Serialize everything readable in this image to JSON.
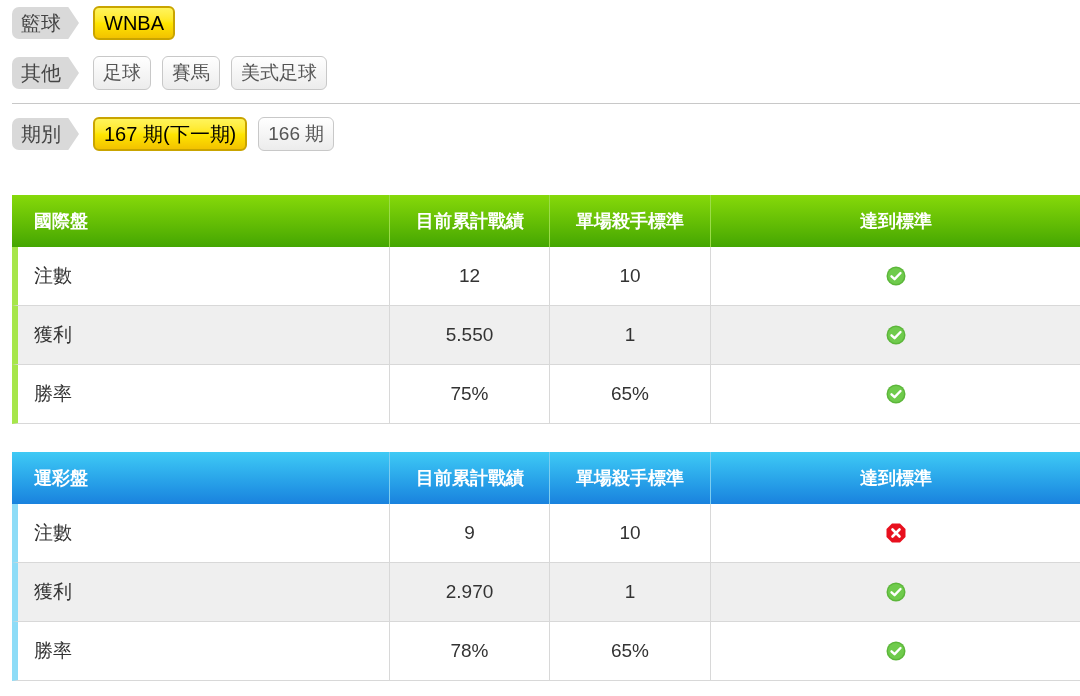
{
  "filters": [
    {
      "label": "籃球",
      "options": [
        {
          "label": "WNBA",
          "selected": true
        }
      ]
    },
    {
      "label": "其他",
      "options": [
        {
          "label": "足球",
          "selected": false
        },
        {
          "label": "賽馬",
          "selected": false
        },
        {
          "label": "美式足球",
          "selected": false
        }
      ]
    },
    {
      "label": "期別",
      "options": [
        {
          "label": "167 期(下一期)",
          "selected": true
        },
        {
          "label": "166 期",
          "selected": false
        }
      ]
    }
  ],
  "tables": [
    {
      "columns": [
        "國際盤",
        "目前累計戰績",
        "單場殺手標準",
        "達到標準"
      ],
      "rows": [
        {
          "label": "注數",
          "current": "12",
          "standard": "10",
          "met": true
        },
        {
          "label": "獲利",
          "current": "5.550",
          "standard": "1",
          "met": true
        },
        {
          "label": "勝率",
          "current": "75%",
          "standard": "65%",
          "met": true
        }
      ]
    },
    {
      "columns": [
        "運彩盤",
        "目前累計戰績",
        "單場殺手標準",
        "達到標準"
      ],
      "rows": [
        {
          "label": "注數",
          "current": "9",
          "standard": "10",
          "met": false
        },
        {
          "label": "獲利",
          "current": "2.970",
          "standard": "1",
          "met": true
        },
        {
          "label": "勝率",
          "current": "78%",
          "standard": "65%",
          "met": true
        }
      ]
    }
  ]
}
